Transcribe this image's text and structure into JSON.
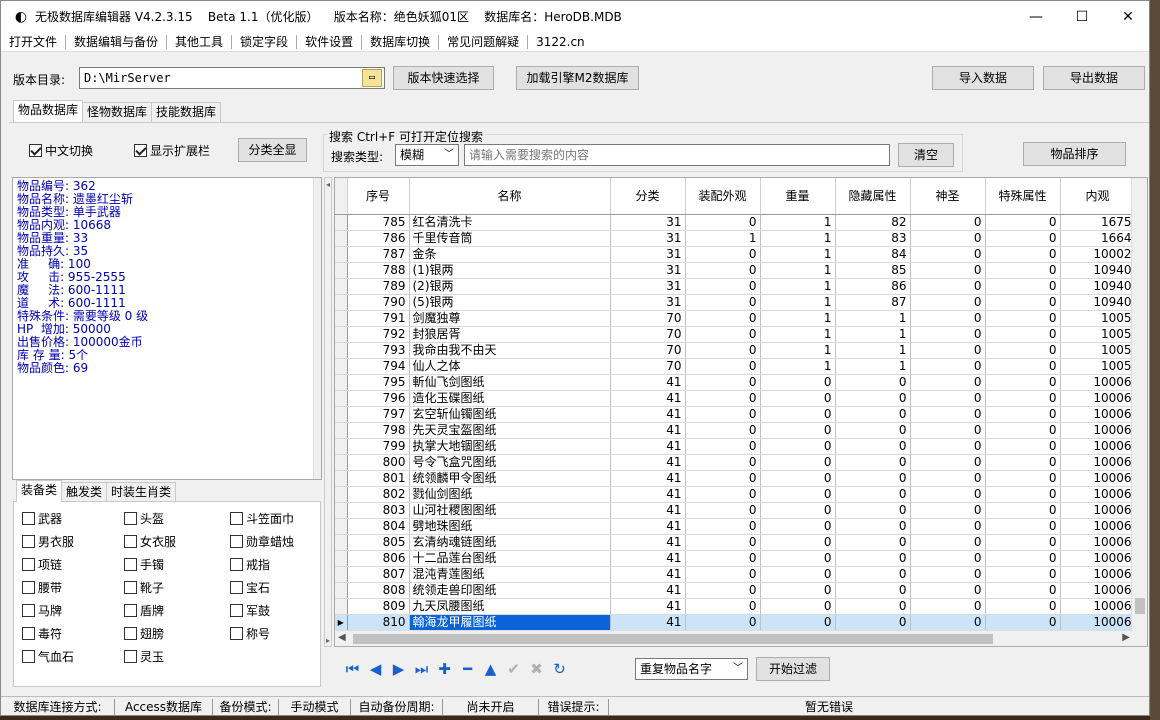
{
  "window": {
    "title": "无极数据库编辑器 V4.2.3.15    Beta 1.1（优化版）    版本名称：绝色妖狐01区    数据库名：HeroDB.MDB",
    "minimize": "—",
    "maximize": "☐",
    "close": "✕"
  },
  "menu": [
    "打开文件",
    "数据编辑与备份",
    "其他工具",
    "锁定字段",
    "软件设置",
    "数据库切换",
    "常见问题解疑",
    "3122.cn"
  ],
  "toolbar": {
    "dir_label": "版本目录:",
    "dir_value": "D:\\MirServer",
    "quick_select": "版本快速选择",
    "load_engine": "加载引擎M2数据库",
    "import": "导入数据",
    "export": "导出数据"
  },
  "main_tabs": [
    "物品数据库",
    "怪物数据库",
    "技能数据库"
  ],
  "options": {
    "chinese_switch": "中文切换",
    "show_ext": "显示扩展栏",
    "show_all": "分类全显",
    "search_title": "搜索   Ctrl+F 可打开定位搜索",
    "search_type_label": "搜索类型:",
    "search_type_value": "模糊",
    "search_placeholder": "请输入需要搜索的内容",
    "clear": "清空",
    "sort": "物品排序"
  },
  "info_lines": [
    "物品编号: 362",
    "物品名称: 遗墨红尘斩",
    "物品类型: 单手武器",
    "物品内观: 10668",
    "物品重量: 33",
    "物品持久: 35",
    "准     确: 100",
    "攻     击: 955-2555",
    "魔     法: 600-1111",
    "道     术: 600-1111",
    "特殊条件: 需要等级 0 级",
    "HP  增加: 50000",
    "出售价格: 100000金币",
    "库 存 量: 5个",
    "物品颜色: 69"
  ],
  "cat_tabs": [
    "装备类",
    "触发类",
    "时装生肖类"
  ],
  "categories": [
    [
      "武器",
      "头盔",
      "斗笠面巾"
    ],
    [
      "男衣服",
      "女衣服",
      "勋章蜡烛"
    ],
    [
      "项链",
      "手镯",
      "戒指"
    ],
    [
      "腰带",
      "靴子",
      "宝石"
    ],
    [
      "马牌",
      "盾牌",
      "军鼓"
    ],
    [
      "毒符",
      "翅膀",
      "称号"
    ],
    [
      "气血石",
      "灵玉",
      ""
    ]
  ],
  "grid": {
    "columns": [
      "序号",
      "名称",
      "分类",
      "装配外观",
      "重量",
      "隐藏属性",
      "神圣",
      "特殊属性",
      "内观"
    ],
    "rows": [
      [
        "785",
        "红名清洗卡",
        "31",
        "0",
        "1",
        "82",
        "0",
        "0",
        "1675"
      ],
      [
        "786",
        "千里传音筒",
        "31",
        "1",
        "1",
        "83",
        "0",
        "0",
        "1664"
      ],
      [
        "787",
        "金条",
        "31",
        "0",
        "1",
        "84",
        "0",
        "0",
        "10002"
      ],
      [
        "788",
        "(1)银两",
        "31",
        "0",
        "1",
        "85",
        "0",
        "0",
        "10940"
      ],
      [
        "789",
        "(2)银两",
        "31",
        "0",
        "1",
        "86",
        "0",
        "0",
        "10940"
      ],
      [
        "790",
        "(5)银两",
        "31",
        "0",
        "1",
        "87",
        "0",
        "0",
        "10940"
      ],
      [
        "791",
        "剑魔独尊",
        "70",
        "0",
        "1",
        "1",
        "0",
        "0",
        "1005"
      ],
      [
        "792",
        "封狼居胥",
        "70",
        "0",
        "1",
        "1",
        "0",
        "0",
        "1005"
      ],
      [
        "793",
        "我命由我不由天",
        "70",
        "0",
        "1",
        "1",
        "0",
        "0",
        "1005"
      ],
      [
        "794",
        "仙人之体",
        "70",
        "0",
        "1",
        "1",
        "0",
        "0",
        "1005"
      ],
      [
        "795",
        "斬仙飞剑图纸",
        "41",
        "0",
        "0",
        "0",
        "0",
        "0",
        "10006"
      ],
      [
        "796",
        "造化玉碟图纸",
        "41",
        "0",
        "0",
        "0",
        "0",
        "0",
        "10006"
      ],
      [
        "797",
        "玄空斩仙镯图纸",
        "41",
        "0",
        "0",
        "0",
        "0",
        "0",
        "10006"
      ],
      [
        "798",
        "先天灵宝盔图纸",
        "41",
        "0",
        "0",
        "0",
        "0",
        "0",
        "10006"
      ],
      [
        "799",
        "执掌大地锢图纸",
        "41",
        "0",
        "0",
        "0",
        "0",
        "0",
        "10006"
      ],
      [
        "800",
        "号令飞盒咒图纸",
        "41",
        "0",
        "0",
        "0",
        "0",
        "0",
        "10006"
      ],
      [
        "801",
        "统领麟甲令图纸",
        "41",
        "0",
        "0",
        "0",
        "0",
        "0",
        "10006"
      ],
      [
        "802",
        "戮仙剑图纸",
        "41",
        "0",
        "0",
        "0",
        "0",
        "0",
        "10006"
      ],
      [
        "803",
        "山河社稷图图纸",
        "41",
        "0",
        "0",
        "0",
        "0",
        "0",
        "10006"
      ],
      [
        "804",
        "劈地珠图纸",
        "41",
        "0",
        "0",
        "0",
        "0",
        "0",
        "10006"
      ],
      [
        "805",
        "玄清纳魂链图纸",
        "41",
        "0",
        "0",
        "0",
        "0",
        "0",
        "10006"
      ],
      [
        "806",
        "十二品莲台图纸",
        "41",
        "0",
        "0",
        "0",
        "0",
        "0",
        "10006"
      ],
      [
        "807",
        "混沌青莲图纸",
        "41",
        "0",
        "0",
        "0",
        "0",
        "0",
        "10006"
      ],
      [
        "808",
        "统领走兽印图纸",
        "41",
        "0",
        "0",
        "0",
        "0",
        "0",
        "10006"
      ],
      [
        "809",
        "九天凤腰图纸",
        "41",
        "0",
        "0",
        "0",
        "0",
        "0",
        "10006"
      ],
      [
        "810",
        "翰海龙甲履图纸",
        "41",
        "0",
        "0",
        "0",
        "0",
        "0",
        "10006"
      ]
    ],
    "selected_index": 25
  },
  "bottom": {
    "dup_select": "重复物品名字",
    "start_filter": "开始过滤"
  },
  "status": [
    "数据库连接方式:",
    "Access数据库",
    "备份模式:",
    "手动模式",
    "自动备份周期:",
    "尚未开启",
    "错误提示:",
    "暂无错误"
  ],
  "accent": "#0a64d8"
}
